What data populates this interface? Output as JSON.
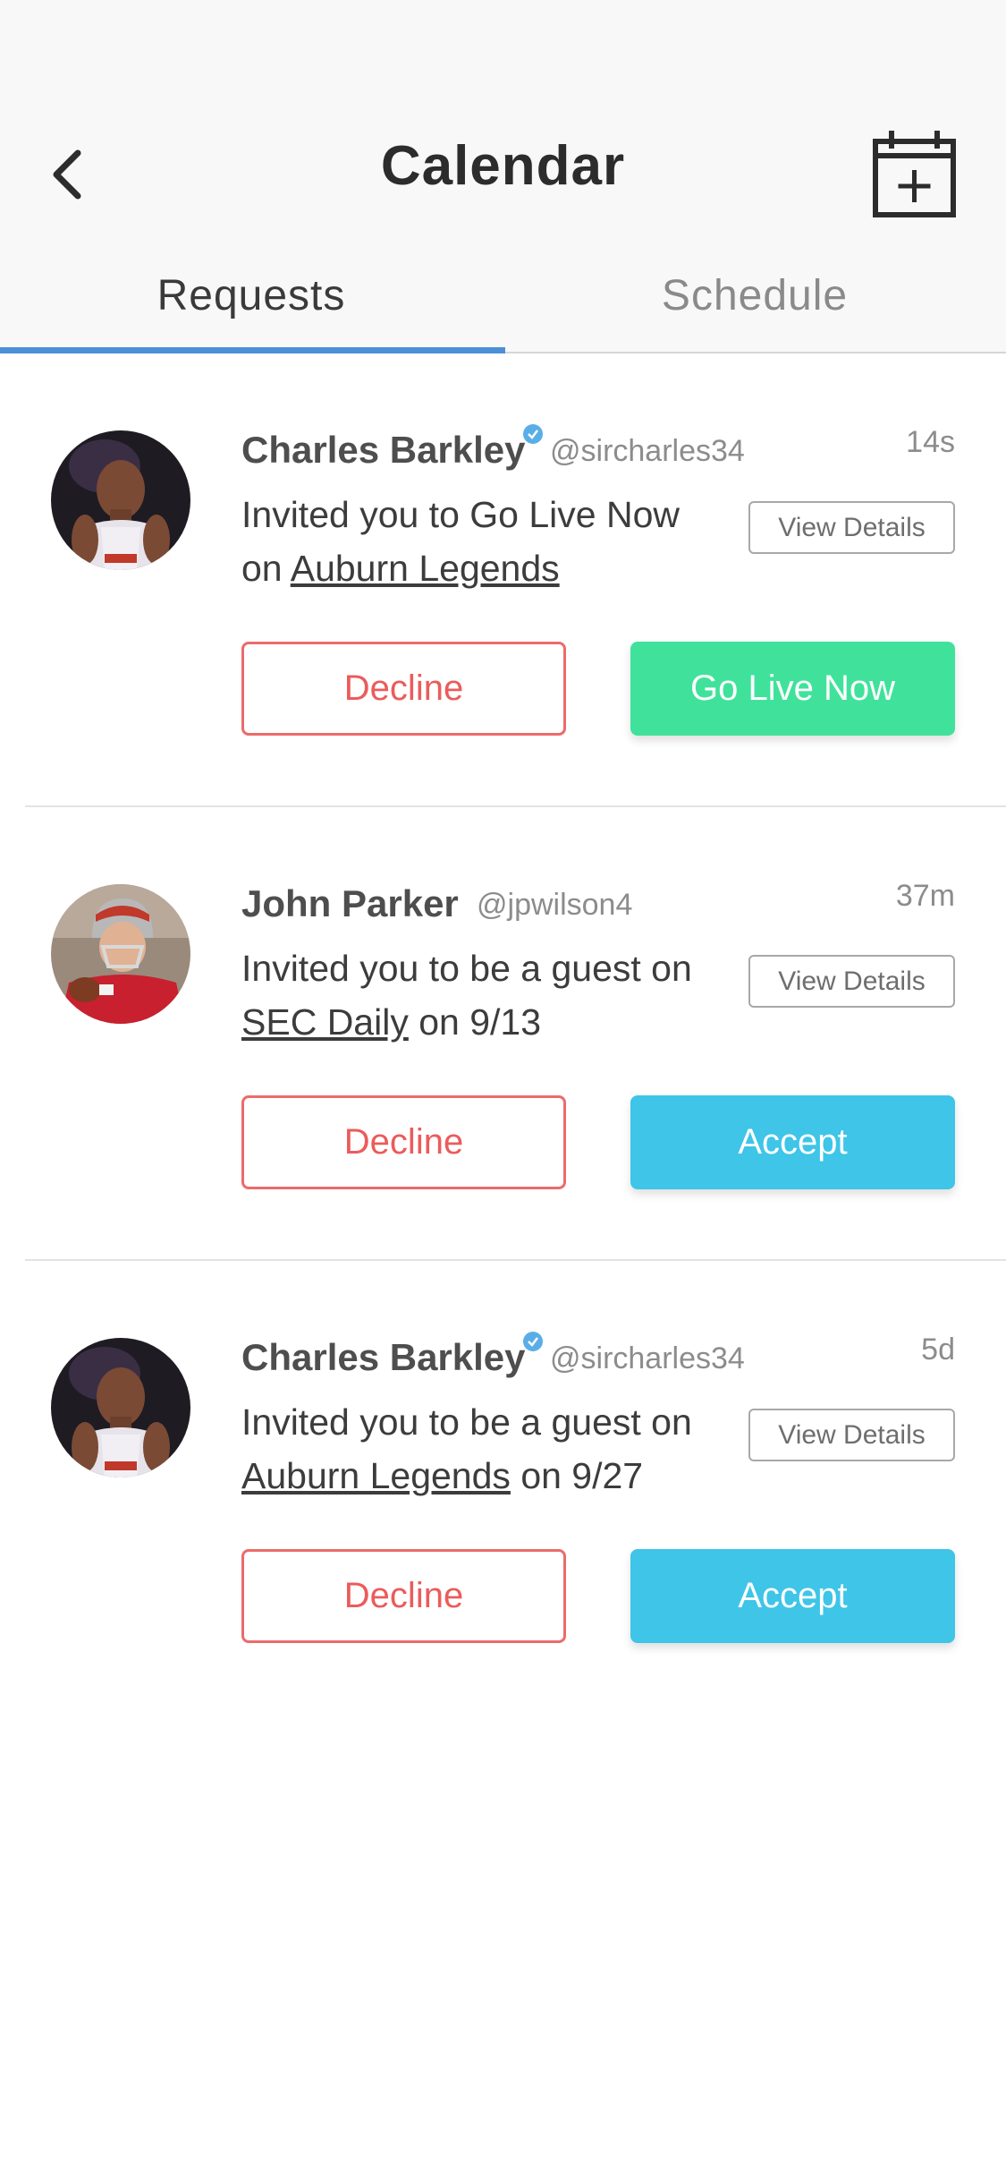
{
  "header": {
    "title": "Calendar",
    "back_icon": "chevron-left-icon",
    "add_icon": "calendar-add-icon"
  },
  "tabs": [
    {
      "label": "Requests",
      "active": true
    },
    {
      "label": "Schedule",
      "active": false
    }
  ],
  "colors": {
    "accent": "#4a90d9",
    "decline": "#ec5b5b",
    "go_live": "#40e29b",
    "accept": "#3ec5e8",
    "verified": "#5aaee8"
  },
  "requests": [
    {
      "name": "Charles Barkley",
      "verified": true,
      "handle": "@sircharles34",
      "time": "14s",
      "message_prefix": "Invited you to Go Live Now on ",
      "message_link": "Auburn Legends",
      "message_suffix": "",
      "view_details": "View Details",
      "decline": "Decline",
      "primary": "Go Live Now",
      "primary_color": "#40e29b"
    },
    {
      "name": "John Parker",
      "verified": false,
      "handle": "@jpwilson4",
      "time": "37m",
      "message_prefix": "Invited you to be a guest on ",
      "message_link": "SEC Daily",
      "message_suffix": " on 9/13",
      "view_details": "View Details",
      "decline": "Decline",
      "primary": "Accept",
      "primary_color": "#3ec5e8"
    },
    {
      "name": "Charles Barkley",
      "verified": true,
      "handle": "@sircharles34",
      "time": "5d",
      "message_prefix": "Invited you to be a guest on ",
      "message_link": "Auburn Legends",
      "message_suffix": " on 9/27",
      "view_details": "View Details",
      "decline": "Decline",
      "primary": "Accept",
      "primary_color": "#3ec5e8"
    }
  ]
}
